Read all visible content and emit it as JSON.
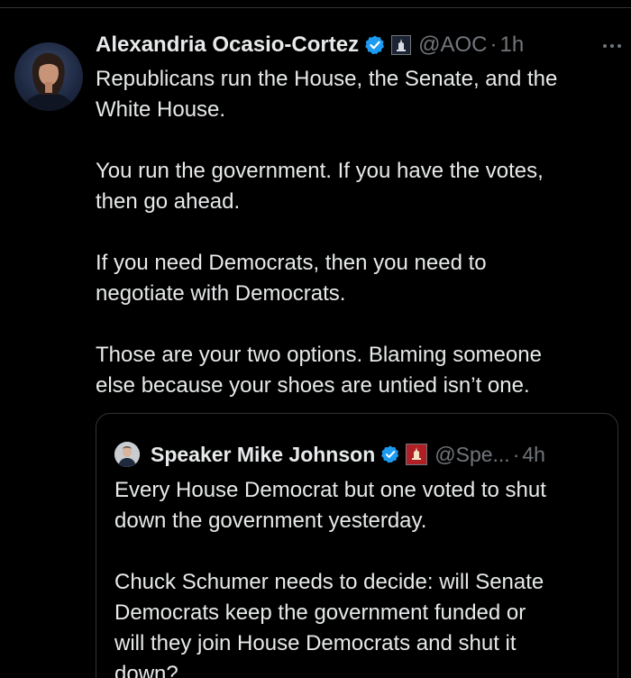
{
  "tweet": {
    "author": {
      "display_name": "Alexandria Ocasio-Cortez",
      "handle": "@AOC",
      "time": "1h",
      "verified_icon": "verified-badge-icon",
      "affiliation_icon": "capitol-affiliation-icon"
    },
    "more_icon": "more-options-icon",
    "text": "Republicans run the House, the Senate, and the\nWhite House.\n\nYou run the government. If you have the votes,\nthen go ahead.\n\nIf you need Democrats, then you need to\nnegotiate with Democrats.\n\nThose are your two options. Blaming someone\nelse because your shoes are untied isn’t one."
  },
  "quoted_tweet": {
    "author": {
      "display_name": "Speaker Mike Johnson",
      "handle": "@Spe...",
      "time": "4h",
      "verified_icon": "verified-badge-icon",
      "affiliation_icon": "speaker-affiliation-icon"
    },
    "text": "Every House Democrat but one voted to shut\ndown the government yesterday.\n\nChuck Schumer needs to decide: will Senate\nDemocrats keep the government funded or\nwill they join House Democrats and shut it\ndown?"
  },
  "separator": "·",
  "colors": {
    "background": "#000000",
    "text_primary": "#e7e9ea",
    "text_secondary": "#71767b",
    "verified_blue": "#1d9bf0",
    "border": "#2f3336"
  }
}
